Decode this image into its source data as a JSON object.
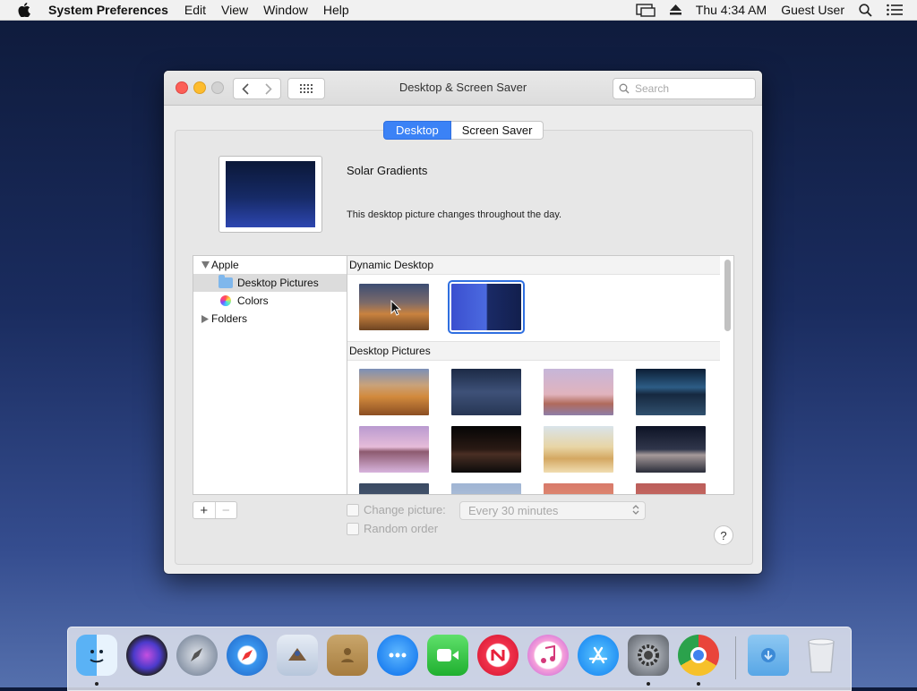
{
  "menubar": {
    "app_name": "System Preferences",
    "items": [
      "Edit",
      "View",
      "Window",
      "Help"
    ],
    "clock": "Thu 4:34 AM",
    "user": "Guest User",
    "icons": [
      "display-mirror-icon",
      "eject-icon",
      "spotlight-search-icon",
      "notification-center-icon"
    ]
  },
  "window": {
    "title": "Desktop & Screen Saver",
    "search_placeholder": "Search",
    "tabs": [
      "Desktop",
      "Screen Saver"
    ],
    "active_tab": "Desktop",
    "current_picture": {
      "name": "Solar Gradients",
      "description": "This desktop picture changes throughout the day."
    },
    "sidebar": {
      "items": [
        {
          "label": "Apple",
          "expanded": true
        },
        {
          "label": "Desktop Pictures",
          "selected": true
        },
        {
          "label": "Colors"
        },
        {
          "label": "Folders",
          "expanded": false
        }
      ]
    },
    "gallery": {
      "sections": [
        {
          "title": "Dynamic Desktop",
          "thumbnails": [
            "mojave-dynamic",
            "solar-gradients"
          ],
          "selected": "solar-gradients"
        },
        {
          "title": "Desktop Pictures",
          "thumbnails": [
            "mojave-day",
            "mojave-night",
            "mojave-pink-rock",
            "mojave-lake-dusk",
            "pink-rock-reflection",
            "city-night",
            "golden-dunes",
            "dark-dunes"
          ]
        }
      ]
    },
    "add_button": "+",
    "remove_button": "−",
    "change_picture_label": "Change picture:",
    "change_picture_interval": "Every 30 minutes",
    "random_order_label": "Random order",
    "help_button": "?"
  },
  "dock": {
    "apps": [
      "Finder",
      "Siri",
      "Launchpad",
      "Safari",
      "Mail",
      "Contacts",
      "Messages",
      "FaceTime",
      "News",
      "iTunes",
      "App Store",
      "System Preferences",
      "Google Chrome",
      "Downloads",
      "Trash"
    ],
    "running": [
      "Finder",
      "System Preferences",
      "Google Chrome"
    ]
  },
  "colors": {
    "accent": "#3b82f6",
    "close": "#fc5f57",
    "minimize": "#fdbc2e"
  }
}
